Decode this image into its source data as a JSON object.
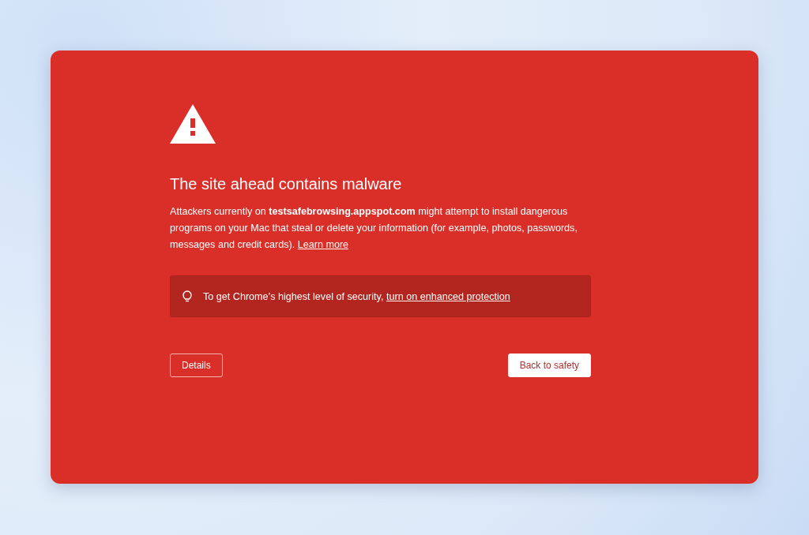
{
  "title": "The site ahead contains malware",
  "message": {
    "text": "Attackers currently on **testsafebrowsing.appspot.com** might attempt to install dangerous programs on your Mac that steal or delete your information (for example, photos, passwords, messages and credit cards).",
    "link": "Learn more"
  },
  "tip": {
    "text": "To get Chrome’s highest level of security,",
    "link": "turn on enhanced protection"
  },
  "buttons": [
    {
      "label": "Details",
      "kind": "outline"
    },
    {
      "label": "Back to safety",
      "kind": "primary"
    }
  ]
}
